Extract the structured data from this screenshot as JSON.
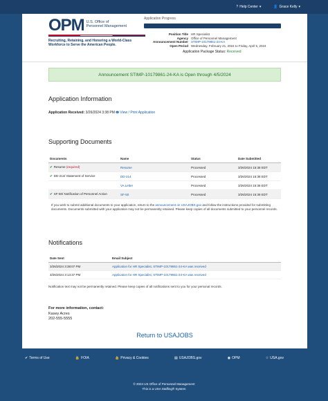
{
  "topbar": {
    "help": "Help Center",
    "user": "Grace Kelly"
  },
  "logo": {
    "wordmark": "OPM",
    "agency_line1": "U.S. Office of",
    "agency_line2": "Personnel Management",
    "tagline1": "Recruiting, Retaining, and Honoring a World-Class",
    "tagline2": "Workforce to Serve the American People."
  },
  "progress": {
    "label": "Application Progress",
    "position_title_k": "Position Title",
    "position_title": "HR Specialist",
    "agency_k": "Agency",
    "agency": "Office of Personnel Management",
    "announcement_k": "Announcement Number",
    "announcement": "STIMP-10179861-24-KA",
    "open_period_k": "Open Period",
    "open_period": "Wednesday, February 21, 2024 to Friday, April 5, 2024",
    "status_k": "Application Package Status:",
    "status": "Received"
  },
  "banner": "Announcement STIMP-10179861-24-KA is Open through 4/5/2024",
  "appinfo": {
    "title": "Application Information",
    "received_k": "Application Received:",
    "received": "3/26/2024 3:38 PM",
    "view_print": "View / Print Application"
  },
  "docs": {
    "title": "Supporting Documents",
    "headers": [
      "Documents",
      "Name",
      "Status",
      "Date Submitted"
    ],
    "required": "(required)",
    "rows": [
      {
        "doc": "Resume",
        "name": "Resume",
        "status": "Processed",
        "date": "3/26/2024 15:38 EDT"
      },
      {
        "doc": "DD-214/ Statement of Service",
        "name": "DD-214",
        "status": "Processed",
        "date": "3/26/2024 15:38 EDT"
      },
      {
        "doc": "",
        "name": "VA Letter",
        "status": "Processed",
        "date": "3/26/2024 15:38 EDT"
      },
      {
        "doc": "SF-50/ Notification of Personnel Action",
        "name": "SF-50",
        "status": "Processed",
        "date": "3/26/2024 15:38 EDT"
      }
    ],
    "note_pre": "If you wish to submit additional documents to your application, return to the ",
    "note_link": "announcement on USAJOBS.gov",
    "note_post": " and follow the instructions provided for submitting documents. Documents submitted with your application may not be permanently retained. Please keep copies of all documents submitted to your personnel records."
  },
  "notif": {
    "title": "Notifications",
    "headers": [
      "Date Sent",
      "Email Subject"
    ],
    "rows": [
      {
        "date": "3/26/2024 3:38:07 PM",
        "subject": "Application for HR Specialist, STIMP-10179861-24-KA was received"
      },
      {
        "date": "3/26/2024 3:13:37 PM",
        "subject": "Application for HR Specialist, STIMP-10179861-24-KA was received"
      }
    ],
    "note": "Notification text may not be permanently retained. Please keep copies of all notifications sent to you for your personal records."
  },
  "contact": {
    "title": "For more information, contact:",
    "name": "Kasey Acres",
    "phone": "202-555-5555"
  },
  "return_link": "Return to USAJOBS",
  "footer": {
    "terms": "Terms of Use",
    "foia": "FOIA",
    "privacy": "Privacy & Cookies",
    "usajobs": "USAJOBS.gov",
    "opm": "OPM",
    "usa": "USA.gov",
    "copyright": "© 2024 US Office of Personnel Management",
    "system": "This is a USA Staffing® System"
  },
  "colors": {
    "navy": "#1b3f68",
    "background": "#1f4d7c",
    "success": "#2e8540",
    "link": "#1a5fa8"
  }
}
